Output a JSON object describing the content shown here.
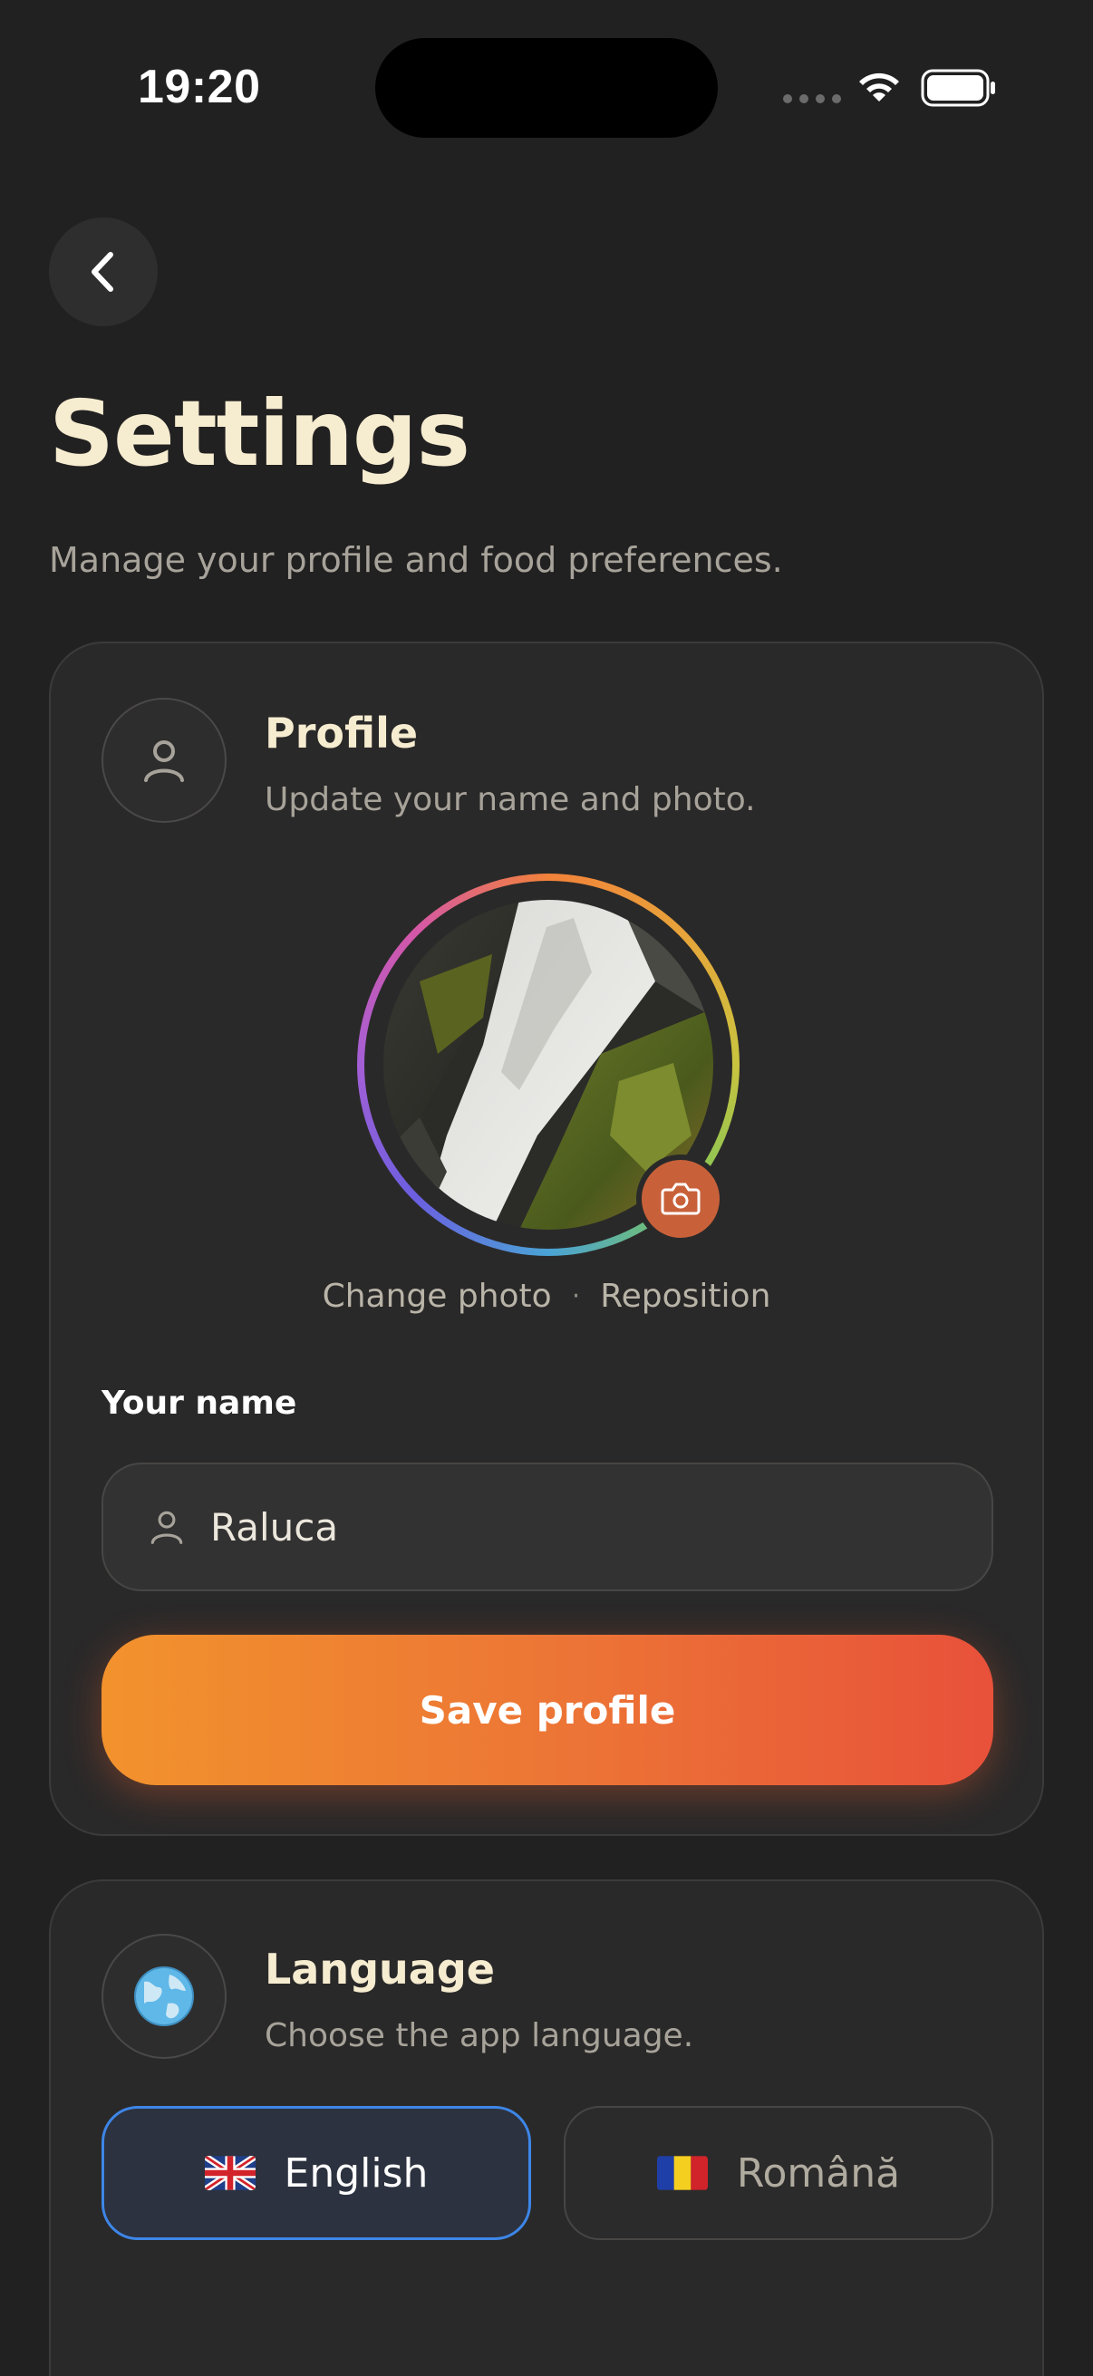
{
  "status_bar": {
    "time": "19:20"
  },
  "header": {
    "back_icon": "chevron-left-icon",
    "title": "Settings",
    "subtitle": "Manage your profile and food preferences."
  },
  "profile_card": {
    "icon": "user-icon",
    "title": "Profile",
    "description": "Update your name and photo.",
    "camera_icon": "camera-icon",
    "change_photo_label": "Change photo",
    "separator": "·",
    "reposition_label": "Reposition",
    "name_label": "Your name",
    "name_value": "Raluca",
    "save_label": "Save profile"
  },
  "language_card": {
    "icon": "globe-icon",
    "title": "Language",
    "description": "Choose the app language.",
    "options": [
      {
        "label": "English",
        "flag": "uk-flag-icon",
        "selected": true
      },
      {
        "label": "Română",
        "flag": "romania-flag-icon",
        "selected": false
      }
    ]
  },
  "colors": {
    "background": "#222121",
    "card": "#2a2929",
    "title": "#f6ecd0",
    "accent_gradient_start": "#f2922d",
    "accent_gradient_end": "#e8513a",
    "selected_border": "#3d86e8"
  }
}
